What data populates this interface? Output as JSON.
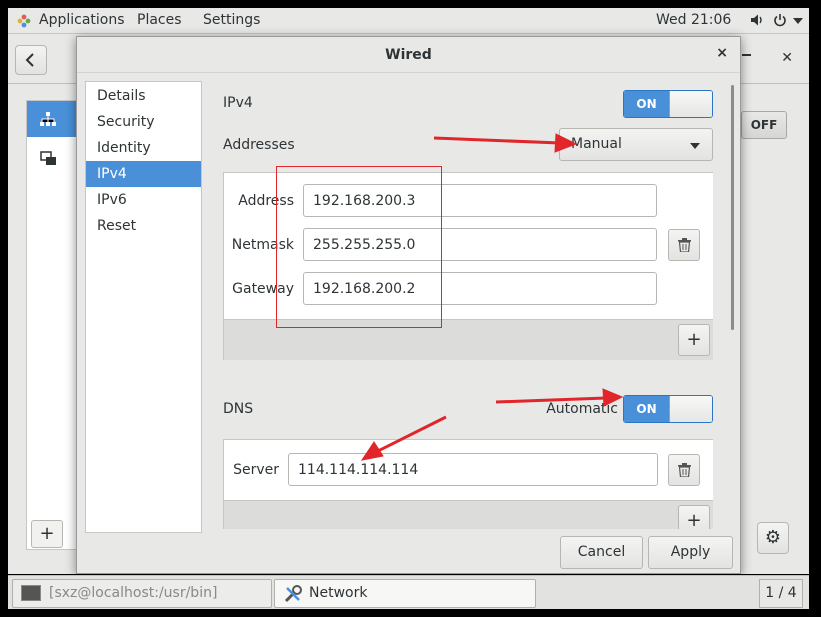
{
  "topbar": {
    "applications": "Applications",
    "places": "Places",
    "settings": "Settings",
    "clock": "Wed 21:06"
  },
  "background_window": {
    "off_label": "OFF",
    "plus_label": "+"
  },
  "dialog": {
    "title": "Wired",
    "close_label": "×",
    "sidebar": [
      {
        "label": "Details"
      },
      {
        "label": "Security"
      },
      {
        "label": "Identity"
      },
      {
        "label": "IPv4",
        "selected": true
      },
      {
        "label": "IPv6"
      },
      {
        "label": "Reset"
      }
    ],
    "ipv4": {
      "title": "IPv4",
      "switch_label": "ON",
      "switch_on": true
    },
    "addresses": {
      "title": "Addresses",
      "method": "Manual",
      "address_label": "Address",
      "address_value": "192.168.200.3",
      "netmask_label": "Netmask",
      "netmask_value": "255.255.255.0",
      "gateway_label": "Gateway",
      "gateway_value": "192.168.200.2",
      "add_label": "+"
    },
    "dns": {
      "title": "DNS",
      "automatic_label": "Automatic",
      "switch_label": "ON",
      "switch_on": true,
      "server_label": "Server",
      "server_value": "114.114.114.114",
      "add_label": "+"
    },
    "buttons": {
      "cancel": "Cancel",
      "apply": "Apply"
    }
  },
  "taskbar": {
    "terminal": "[sxz@localhost:/usr/bin]",
    "network": "Network",
    "pager": "1 / 4"
  },
  "colors": {
    "accent": "#4a90d9",
    "annotation": "#e0262a"
  }
}
